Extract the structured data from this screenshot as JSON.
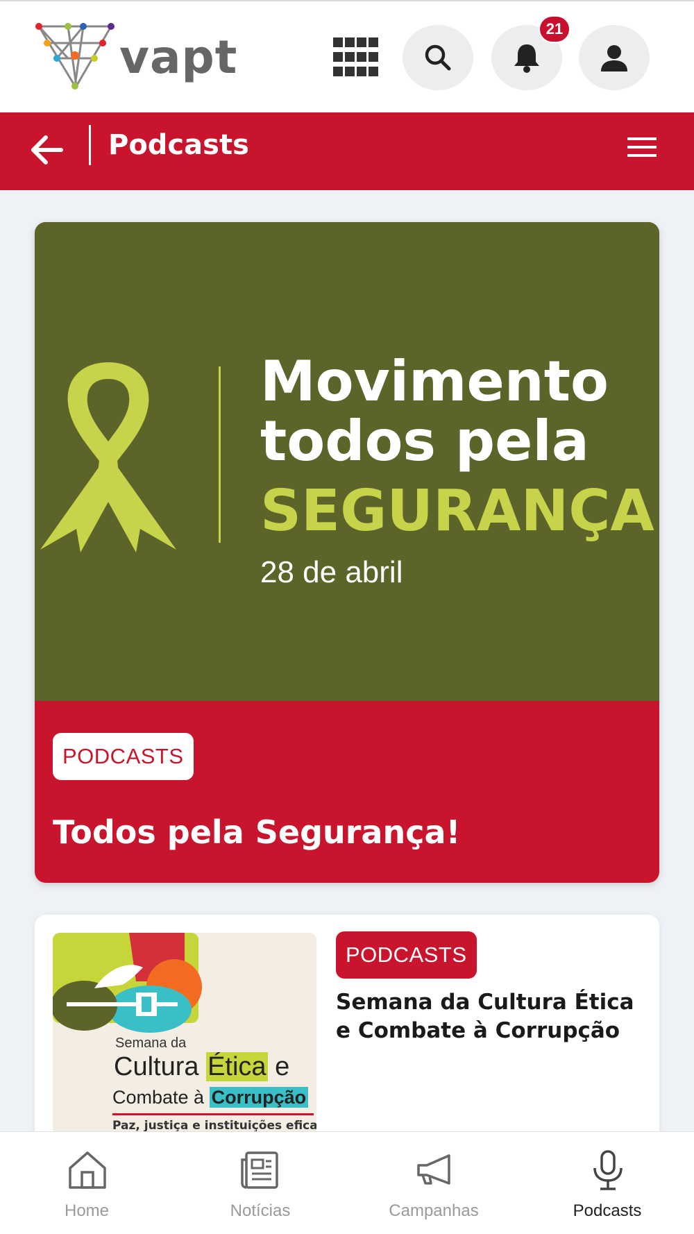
{
  "header": {
    "logo_text": "vapt",
    "notification_count": "21"
  },
  "titlebar": {
    "title": "Podcasts"
  },
  "featured": {
    "image": {
      "line1": "Movimento",
      "line2": "todos pela",
      "line3": "SEGURANÇA",
      "date": "28 de abril"
    },
    "tag": "PODCASTS",
    "title": "Todos pela Segurança!"
  },
  "list": [
    {
      "thumbnail": {
        "line1": "Semana da",
        "line2a": "Cultura ",
        "line2b": "Ética",
        "line2c": " e",
        "line3a": "Combate à ",
        "line3b": "Corrupção",
        "line4": "Paz, justiça e instituições eficazes"
      },
      "tag": "PODCASTS",
      "title": "Semana da Cultura Ética e Combate à Corrupção"
    }
  ],
  "bottom_nav": {
    "items": [
      {
        "label": "Home",
        "icon": "home-icon"
      },
      {
        "label": "Notícias",
        "icon": "newspaper-icon"
      },
      {
        "label": "Campanhas",
        "icon": "megaphone-icon"
      },
      {
        "label": "Podcasts",
        "icon": "microphone-icon",
        "active": true
      }
    ]
  },
  "colors": {
    "brand_red": "#c8142c",
    "olive": "#5c6429",
    "lime": "#c7d34a"
  }
}
